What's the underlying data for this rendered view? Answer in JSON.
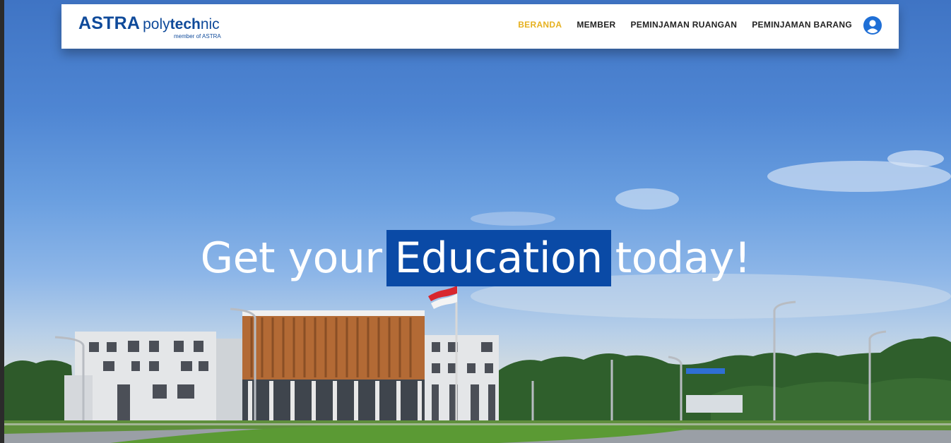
{
  "brand": {
    "name": "ASTRA",
    "product_light": "poly",
    "product_bold": "tech",
    "product_tail": "nic",
    "tagline": "member of ASTRA",
    "color": "#0f4a9a"
  },
  "nav": {
    "items": [
      {
        "label": "BERANDA",
        "active": true
      },
      {
        "label": "MEMBER",
        "active": false
      },
      {
        "label": "PEMINJAMAN RUANGAN",
        "active": false
      },
      {
        "label": "PEMINJAMAN BARANG",
        "active": false
      }
    ],
    "active_color": "#e6b120",
    "user_icon": "user-circle-icon"
  },
  "hero": {
    "before": "Get your",
    "highlight": "Education",
    "after": "today!",
    "highlight_color": "#0a4aa6"
  }
}
